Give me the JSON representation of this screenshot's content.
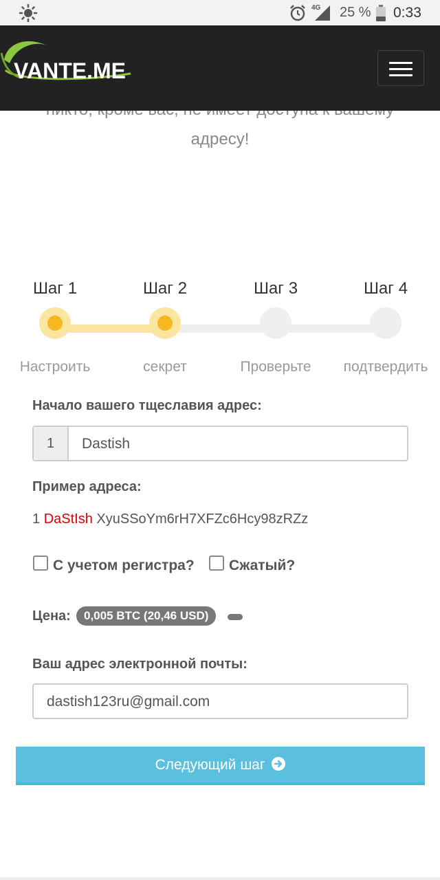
{
  "status_bar": {
    "network": "4G",
    "battery": "25 %",
    "time": "0:33"
  },
  "navbar": {
    "logo_text": "VANTE.ME"
  },
  "intro": {
    "line1": "никто, кроме вас, не имеет доступа к вашему",
    "line2": "адресу!"
  },
  "stepper": {
    "steps": [
      {
        "title": "Шаг 1",
        "label": "Настроить",
        "active": true
      },
      {
        "title": "Шаг 2",
        "label": "секрет",
        "active": true
      },
      {
        "title": "Шаг 3",
        "label": "Проверьте",
        "active": false
      },
      {
        "title": "Шаг 4",
        "label": "подтвердить",
        "active": false
      }
    ],
    "colors": {
      "active_track": "#fce5a0",
      "inactive_track": "#efefef",
      "active_dot": "#f7b71f"
    }
  },
  "form": {
    "prefix_label": "Начало вашего тщеславия адрес:",
    "prefix_addon": "1",
    "prefix_value": "Dastish",
    "example_label": "Пример адреса:",
    "example_prefix": "1 ",
    "example_highlight": "DaStIsh",
    "example_rest": " XyuSSoYm6rH7XFZc6Hcy98zRZz",
    "case_sensitive_label": "С учетом регистра?",
    "compressed_label": "Сжатый?",
    "price_label": "Цена:",
    "price_value": "0,005 BTC (20,46 USD)",
    "email_label": "Ваш адрес электронной почты:",
    "email_value": "dastish123ru@gmail.com",
    "next_button_label": "Следующий шаг"
  },
  "colors": {
    "navbar": "#222222",
    "button": "#5bc0de",
    "highlight": "#dd0000",
    "badge": "#777777"
  }
}
